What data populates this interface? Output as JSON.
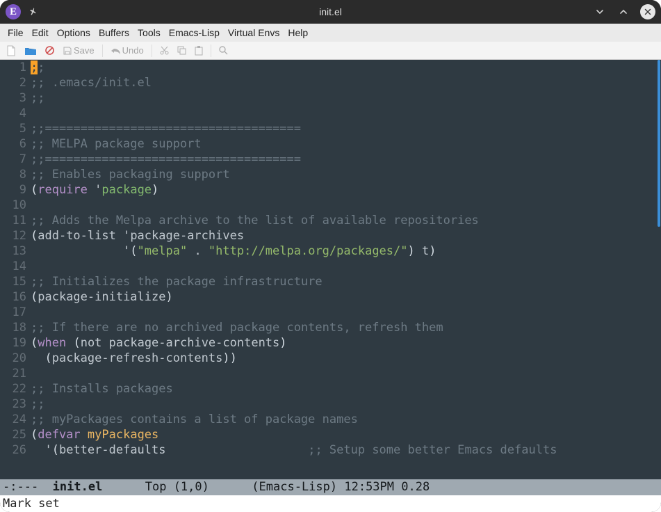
{
  "titlebar": {
    "title": "init.el"
  },
  "menubar": [
    "File",
    "Edit",
    "Options",
    "Buffers",
    "Tools",
    "Emacs-Lisp",
    "Virtual Envs",
    "Help"
  ],
  "toolbar": {
    "save_label": "Save",
    "undo_label": "Undo"
  },
  "code": {
    "lines": [
      {
        "n": "1",
        "seg": [
          {
            "cls": "cursor-on",
            "t": ";"
          },
          {
            "cls": "c-comment",
            "t": ";"
          }
        ]
      },
      {
        "n": "2",
        "seg": [
          {
            "cls": "c-comment",
            "t": ";; .emacs/init.el"
          }
        ]
      },
      {
        "n": "3",
        "seg": [
          {
            "cls": "c-comment",
            "t": ";;"
          }
        ]
      },
      {
        "n": "4",
        "seg": []
      },
      {
        "n": "5",
        "seg": [
          {
            "cls": "c-comment",
            "t": ";;===================================="
          }
        ]
      },
      {
        "n": "6",
        "seg": [
          {
            "cls": "c-comment",
            "t": ";; MELPA package support"
          }
        ]
      },
      {
        "n": "7",
        "seg": [
          {
            "cls": "c-comment",
            "t": ";;===================================="
          }
        ]
      },
      {
        "n": "8",
        "seg": [
          {
            "cls": "c-comment",
            "t": ";; Enables packaging support"
          }
        ]
      },
      {
        "n": "9",
        "seg": [
          {
            "cls": "c-paren",
            "t": "("
          },
          {
            "cls": "c-kw",
            "t": "require"
          },
          {
            "cls": "c-plain",
            "t": " '"
          },
          {
            "cls": "c-sym",
            "t": "package"
          },
          {
            "cls": "c-paren",
            "t": ")"
          }
        ]
      },
      {
        "n": "10",
        "seg": []
      },
      {
        "n": "11",
        "seg": [
          {
            "cls": "c-comment",
            "t": ";; Adds the Melpa archive to the list of available repositories"
          }
        ]
      },
      {
        "n": "12",
        "seg": [
          {
            "cls": "c-paren",
            "t": "("
          },
          {
            "cls": "c-plain",
            "t": "add-to-list '"
          },
          {
            "cls": "c-plain",
            "t": "package-archives"
          }
        ]
      },
      {
        "n": "13",
        "seg": [
          {
            "cls": "c-plain",
            "t": "             '"
          },
          {
            "cls": "c-paren",
            "t": "("
          },
          {
            "cls": "c-str",
            "t": "\"melpa\""
          },
          {
            "cls": "c-plain",
            "t": " . "
          },
          {
            "cls": "c-str",
            "t": "\"http://melpa.org/packages/\""
          },
          {
            "cls": "c-paren",
            "t": ")"
          },
          {
            "cls": "c-plain",
            "t": " t"
          },
          {
            "cls": "c-paren",
            "t": ")"
          }
        ]
      },
      {
        "n": "14",
        "seg": []
      },
      {
        "n": "15",
        "seg": [
          {
            "cls": "c-comment",
            "t": ";; Initializes the package infrastructure"
          }
        ]
      },
      {
        "n": "16",
        "seg": [
          {
            "cls": "c-paren",
            "t": "("
          },
          {
            "cls": "c-plain",
            "t": "package-initialize"
          },
          {
            "cls": "c-paren",
            "t": ")"
          }
        ]
      },
      {
        "n": "17",
        "seg": []
      },
      {
        "n": "18",
        "seg": [
          {
            "cls": "c-comment",
            "t": ";; If there are no archived package contents, refresh them"
          }
        ]
      },
      {
        "n": "19",
        "seg": [
          {
            "cls": "c-paren",
            "t": "("
          },
          {
            "cls": "c-kw",
            "t": "when"
          },
          {
            "cls": "c-plain",
            "t": " "
          },
          {
            "cls": "c-paren",
            "t": "("
          },
          {
            "cls": "c-plain",
            "t": "not package-archive-contents"
          },
          {
            "cls": "c-paren",
            "t": ")"
          }
        ]
      },
      {
        "n": "20",
        "seg": [
          {
            "cls": "c-plain",
            "t": "  "
          },
          {
            "cls": "c-paren",
            "t": "("
          },
          {
            "cls": "c-plain",
            "t": "package-refresh-contents"
          },
          {
            "cls": "c-paren",
            "t": "))"
          }
        ]
      },
      {
        "n": "21",
        "seg": []
      },
      {
        "n": "22",
        "seg": [
          {
            "cls": "c-comment",
            "t": ";; Installs packages"
          }
        ]
      },
      {
        "n": "23",
        "seg": [
          {
            "cls": "c-comment",
            "t": ";;"
          }
        ]
      },
      {
        "n": "24",
        "seg": [
          {
            "cls": "c-comment",
            "t": ";; myPackages contains a list of package names"
          }
        ]
      },
      {
        "n": "25",
        "seg": [
          {
            "cls": "c-paren",
            "t": "("
          },
          {
            "cls": "c-kw",
            "t": "defvar"
          },
          {
            "cls": "c-plain",
            "t": " "
          },
          {
            "cls": "c-var",
            "t": "myPackages"
          }
        ]
      },
      {
        "n": "26",
        "seg": [
          {
            "cls": "c-plain",
            "t": "  '"
          },
          {
            "cls": "c-paren",
            "t": "("
          },
          {
            "cls": "c-plain",
            "t": "better-defaults"
          },
          {
            "cls": "c-plain",
            "t": "                    "
          },
          {
            "cls": "c-comment",
            "t": ";; Setup some better Emacs defaults"
          }
        ]
      }
    ]
  },
  "modeline": {
    "flags": "-:--- ",
    "filename": "init.el",
    "gap1": "      ",
    "pos": "Top (1,0)",
    "gap2": "      ",
    "mode": "(Emacs-Lisp)",
    "time": " 12:53PM 0.28"
  },
  "minibuffer": "Mark set"
}
